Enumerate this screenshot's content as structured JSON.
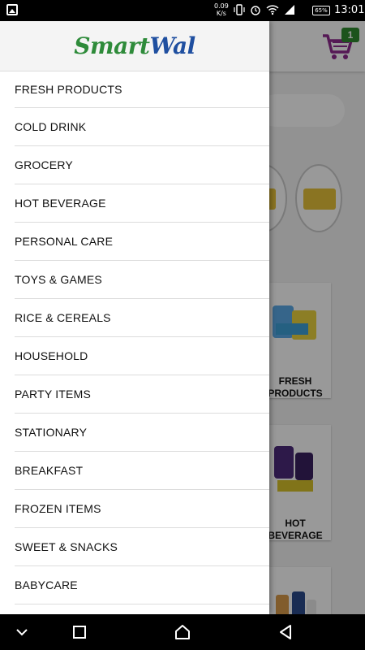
{
  "status_bar": {
    "net_speed_value": "0.09",
    "net_speed_unit": "K/s",
    "battery": "65%",
    "time": "13:01"
  },
  "app": {
    "cart_count": "1",
    "cards": [
      {
        "label_line1": "FRESH",
        "label_line2": "PRODUCTS"
      },
      {
        "label_line1": "HOT",
        "label_line2": "BEVERAGE"
      }
    ]
  },
  "drawer": {
    "logo_smart": "Smart",
    "logo_wal": "Wal",
    "items": [
      "FRESH PRODUCTS",
      "COLD DRINK",
      "GROCERY",
      "HOT BEVERAGE",
      "PERSONAL CARE",
      "TOYS & GAMES",
      "RICE & CEREALS",
      "HOUSEHOLD",
      "PARTY ITEMS",
      "STATIONARY",
      "BREAKFAST",
      "FROZEN ITEMS",
      "SWEET & SNACKS",
      "BABYCARE"
    ]
  },
  "colors": {
    "brand_green": "#2e8b3a",
    "brand_blue": "#1f4fa0",
    "cart_purple": "#8e2a8e",
    "badge_green": "#2f8a2f"
  },
  "icons": {
    "status_left": "image-icon",
    "vibrate": "vibrate-icon",
    "alarm": "alarm-icon",
    "wifi": "wifi-icon",
    "signal": "signal-icon",
    "cart": "cart-icon",
    "nav_down": "chevron-down-icon",
    "nav_recent": "recent-apps-icon",
    "nav_home": "home-icon",
    "nav_back": "back-icon"
  }
}
